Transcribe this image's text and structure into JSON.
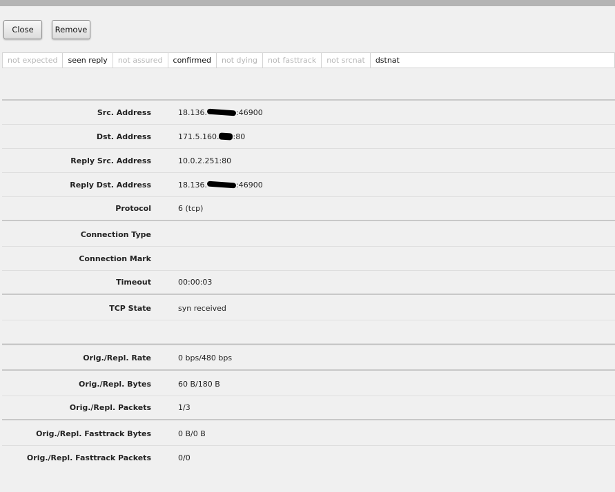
{
  "toolbar": {
    "close_label": "Close",
    "remove_label": "Remove"
  },
  "flags": [
    {
      "label": "not expected",
      "active": false
    },
    {
      "label": "seen reply",
      "active": true
    },
    {
      "label": "not assured",
      "active": false
    },
    {
      "label": "confirmed",
      "active": true
    },
    {
      "label": "not dying",
      "active": false
    },
    {
      "label": "not fasttrack",
      "active": false
    },
    {
      "label": "not srcnat",
      "active": false
    },
    {
      "label": "dstnat",
      "active": true
    }
  ],
  "fields": {
    "src_address": {
      "label": "Src. Address",
      "prefix": "18.136.",
      "suffix": ":46900"
    },
    "dst_address": {
      "label": "Dst. Address",
      "prefix": "171.5.160.",
      "suffix": ":80"
    },
    "reply_src_address": {
      "label": "Reply Src. Address",
      "value": "10.0.2.251:80"
    },
    "reply_dst_address": {
      "label": "Reply Dst. Address",
      "prefix": "18.136.",
      "suffix": ":46900"
    },
    "protocol": {
      "label": "Protocol",
      "value": "6 (tcp)"
    },
    "connection_type": {
      "label": "Connection Type",
      "value": ""
    },
    "connection_mark": {
      "label": "Connection Mark",
      "value": ""
    },
    "timeout": {
      "label": "Timeout",
      "value": "00:00:03"
    },
    "tcp_state": {
      "label": "TCP State",
      "value": "syn received"
    },
    "rate": {
      "label": "Orig./Repl. Rate",
      "value": "0 bps/480 bps"
    },
    "bytes": {
      "label": "Orig./Repl. Bytes",
      "value": "60 B/180 B"
    },
    "packets": {
      "label": "Orig./Repl. Packets",
      "value": "1/3"
    },
    "fasttrack_bytes": {
      "label": "Orig./Repl. Fasttrack Bytes",
      "value": "0 B/0 B"
    },
    "fasttrack_packets": {
      "label": "Orig./Repl. Fasttrack Packets",
      "value": "0/0"
    }
  }
}
